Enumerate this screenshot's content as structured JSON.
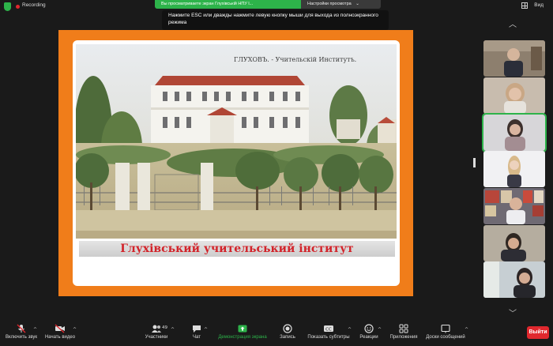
{
  "topbar": {
    "recording_label": "Recording",
    "view_label": "Вид"
  },
  "share_banner": {
    "status_text": "Вы просматриваете экран Глухівській НПУ l...",
    "settings_label": "Настройки просмотра"
  },
  "tooltip": {
    "text": "Нажмите ESC или дважды нажмите левую кнопку мыши для выхода из полноэкранного режима"
  },
  "slide": {
    "header_text": "ГЛУХОВЪ. - Учительскій Институтъ.",
    "caption": "Глухівський учительський інститут"
  },
  "toolbar": {
    "unmute_label": "Включить звук",
    "start_video_label": "Начать видео",
    "participants_label": "Участники",
    "participants_count": "49",
    "chat_label": "Чат",
    "share_label": "Демонстрация экрана",
    "record_label": "Запись",
    "captions_label": "Показать субтитры",
    "reactions_label": "Реакции",
    "apps_label": "Приложения",
    "whiteboards_label": "Доски сообщений",
    "leave_label": "Выйти"
  },
  "colors": {
    "accent_green": "#2db34a",
    "leave_red": "#e0282e",
    "slide_orange": "#f07d1a",
    "caption_red": "#d2232a"
  }
}
